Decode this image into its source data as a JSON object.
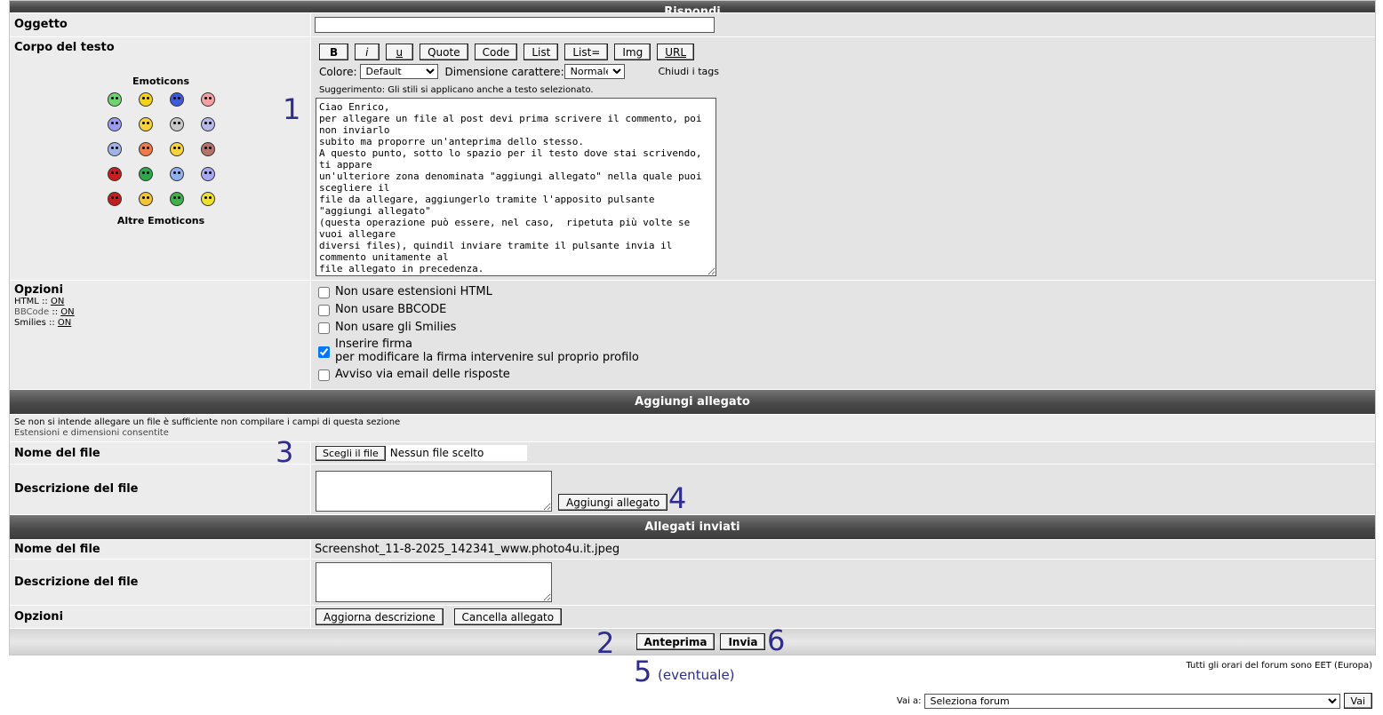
{
  "header_top": "Rispondi",
  "oggetto": {
    "label": "Oggetto",
    "value": ""
  },
  "corpo": {
    "label": "Corpo del testo",
    "emoticons_title": "Emoticons",
    "emoticons_more": "Altre Emoticons",
    "format_buttons": [
      "B",
      "i",
      "u",
      "Quote",
      "Code",
      "List",
      "List=",
      "Img",
      "URL"
    ],
    "colore_label": "Colore:",
    "colore_value": "Default",
    "dimensione_label": "Dimensione carattere:",
    "dimensione_value": "Normale",
    "chiudi_tags": "Chiudi i tags",
    "suggerimento": "Suggerimento: Gli stili si applicano anche a testo selezionato.",
    "text": "Ciao Enrico,\nper allegare un file al post devi prima scrivere il commento, poi non inviarlo\nsubito ma proporre un'anteprima dello stesso.\nA questo punto, sotto lo spazio per il testo dove stai scrivendo, ti appare\nun'ulteriore zona denominata \"aggiungi allegato\" nella quale puoi scegliere il\nfile da allegare, aggiungerlo tramite l'apposito pulsante \"aggiungi allegato\"\n(questa operazione può essere, nel caso,  ripetuta più volte se vuoi allegare\ndiversi files), quindil inviare tramite il pulsante invia il commento unitamente al\nfile allegato in precedenza.\nCon questa procedura dovresti riuscire a inviare la tua nuova proposta."
  },
  "emoticon_colors": [
    "#6fd36f",
    "#f2d21a",
    "#3d5bd8",
    "#f4a0a0",
    "#9b9bef",
    "#f5d23a",
    "#c8c8c8",
    "#b8b8e8",
    "#9fb3e6",
    "#f07a4a",
    "#f7d43c",
    "#b5736a",
    "#c81e1e",
    "#2fa84a",
    "#8fb1ee",
    "#a7a7f2",
    "#c02020",
    "#f2c43a",
    "#3fb04a",
    "#eedf30"
  ],
  "opzioni": {
    "label": "Opzioni",
    "html_label": "HTML",
    "html_value": "ON",
    "bbcode_label": "BBCode",
    "bbcode_value": "ON",
    "smilies_label": "Smilies",
    "smilies_value": "ON",
    "sep": "::",
    "chk1": "Non usare estensioni HTML",
    "chk2": "Non usare BBCODE",
    "chk3": "Non usare gli Smilies",
    "chk4a": "Inserire firma",
    "chk4b": "per modificare la firma intervenire sul proprio profilo",
    "chk5": "Avviso via email delle risposte"
  },
  "allegato": {
    "header": "Aggiungi allegato",
    "info": "Se non si intende allegare un file è sufficiente non compilare i campi di questa sezione",
    "estensioni": "Estensioni e dimensioni consentite",
    "nome_label": "Nome del file",
    "choose_button": "Scegli il file",
    "no_file": "Nessun file scelto",
    "descr_label": "Descrizione del file",
    "add_button": "Aggiungi allegato"
  },
  "inviati": {
    "header": "Allegati inviati",
    "nome_label": "Nome del file",
    "filename": "Screenshot_11-8-2025_142341_www.photo4u.it.jpeg",
    "descr_label": "Descrizione del file",
    "opzioni_label": "Opzioni",
    "update_button": "Aggiorna descrizione",
    "delete_button": "Cancella allegato"
  },
  "bottom": {
    "anteprima": "Anteprima",
    "invia": "Invia",
    "timezone": "Tutti gli orari del forum sono EET (Europa)",
    "vai_label": "Vai a:",
    "forum_select": "Seleziona forum",
    "vai_button": "Vai"
  },
  "annotations": {
    "a1": "1",
    "a2": "2",
    "a3": "3",
    "a4": "4",
    "a5": "5",
    "a5note": "(eventuale)",
    "a6": "6"
  }
}
